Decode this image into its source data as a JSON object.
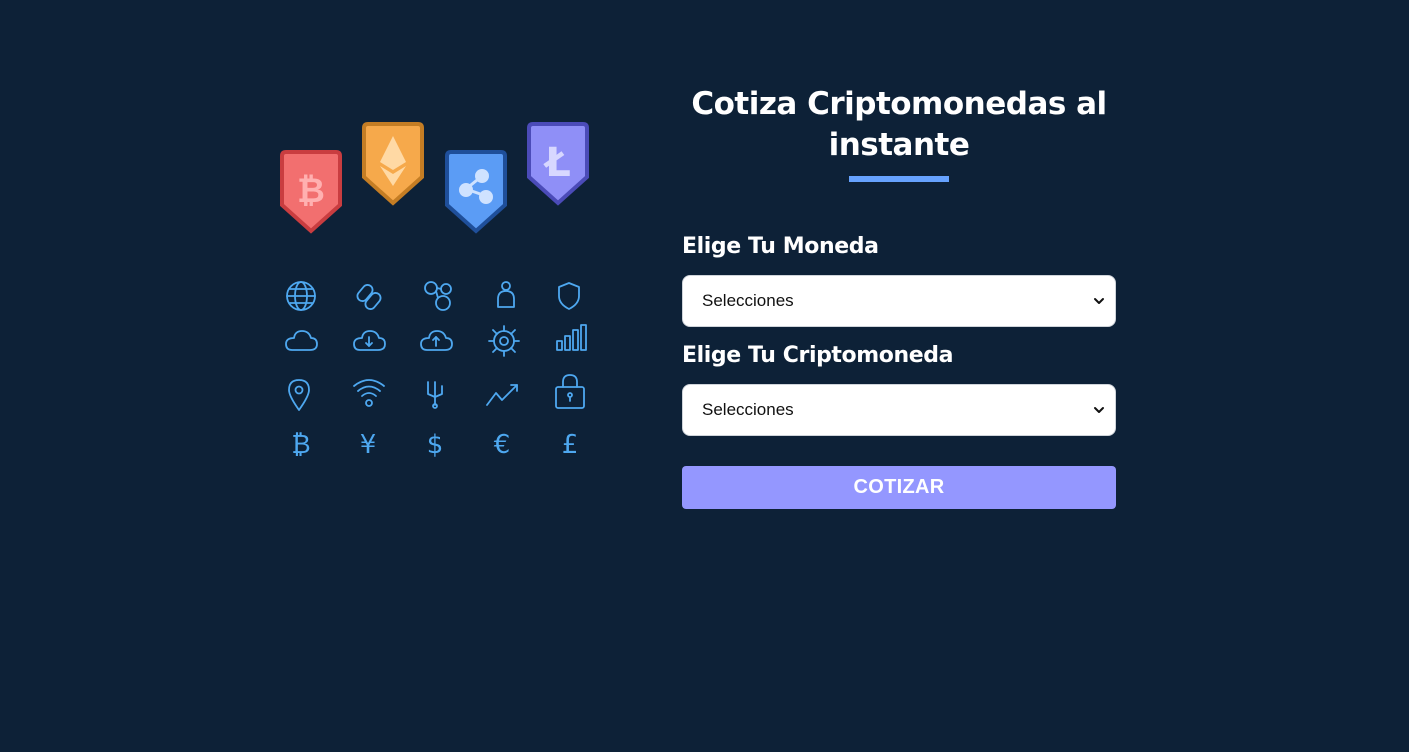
{
  "header": {
    "title": "Cotiza Criptomonedas al instante"
  },
  "form": {
    "currency_label": "Elige Tu Moneda",
    "currency_value": "Selecciones",
    "crypto_label": "Elige Tu Criptomoneda",
    "crypto_value": "Selecciones",
    "submit_label": "Cotizar"
  },
  "hero": {
    "coin_icons": [
      "bitcoin-badge-icon",
      "ethereum-badge-icon",
      "ripple-badge-icon",
      "litecoin-badge-icon"
    ],
    "grid_icons": [
      "globe-icon",
      "link-icon",
      "network-icon",
      "user-icon",
      "shield-icon",
      "cloud-icon",
      "cloud-download-icon",
      "cloud-upload-icon",
      "gear-icon",
      "bar-chart-icon",
      "location-pin-icon",
      "wifi-icon",
      "usb-icon",
      "trend-up-icon",
      "padlock-icon",
      "bitcoin-symbol-icon",
      "yen-symbol-icon",
      "dollar-symbol-icon",
      "euro-symbol-icon",
      "pound-symbol-icon"
    ]
  },
  "colors": {
    "background": "#0d2137",
    "accent_underline": "#66a2fe",
    "button": "#9497ff",
    "icon_stroke": "#4ea8f0",
    "bitcoin_badge": "#f26f6f",
    "ethereum_badge": "#f6a94b",
    "ripple_badge": "#5b9cf5",
    "litecoin_badge": "#8f8ff7"
  }
}
